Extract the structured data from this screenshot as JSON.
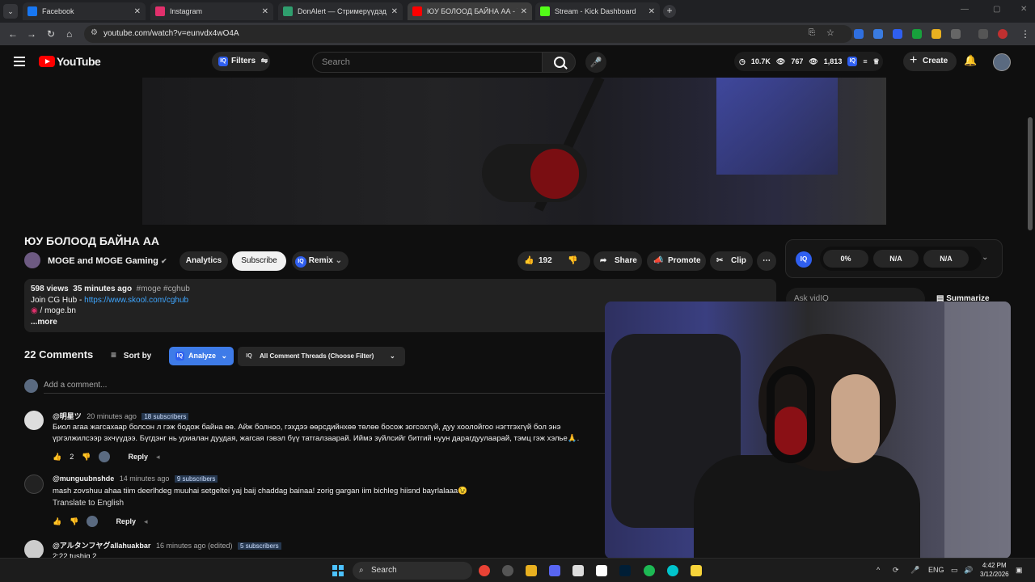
{
  "browser": {
    "tabs": [
      {
        "title": "Facebook",
        "color": "#1877f2"
      },
      {
        "title": "Instagram",
        "color": "#e1306c"
      },
      {
        "title": "DonAlert — Стримерүүдэд зор",
        "color": "#2f9e6e"
      },
      {
        "title": "ЮУ БОЛООД БАЙНА АА - You",
        "color": "#ff0000"
      },
      {
        "title": "Stream - Kick Dashboard",
        "color": "#53fc18"
      }
    ],
    "url": "youtube.com/watch?v=eunvdx4wO4A"
  },
  "header": {
    "logo_text": "YouTube",
    "filters_label": "Filters",
    "search_placeholder": "Search",
    "stats": {
      "views": "10.7K",
      "watching": "767",
      "other": "1,813"
    },
    "create_label": "Create"
  },
  "video": {
    "title": "ЮУ БОЛООД БАЙНА АА",
    "channel": "MOGE and MOGE Gaming",
    "analytics_label": "Analytics",
    "subscribe_label": "Subscribe",
    "remix_label": "Remix",
    "likes": "192",
    "share_label": "Share",
    "promote_label": "Promote",
    "clip_label": "Clip"
  },
  "description": {
    "views": "598 views",
    "time": "35 minutes ago",
    "tags": "#moge #cghub",
    "line1_prefix": "Join CG Hub - ",
    "line1_link": "https://www.skool.com/cghub",
    "line2": "/ moge.bn",
    "more": "...more"
  },
  "comments": {
    "count_label": "22 Comments",
    "sort_label": "Sort by",
    "analyze_label": "Analyze",
    "threads_label": "All Comment Threads (Choose Filter)",
    "add_placeholder": "Add a comment...",
    "reply_label": "Reply",
    "translate_label": "Translate to English",
    "items": [
      {
        "author": "@明星ツ",
        "time": "20 minutes ago",
        "subs": "18 subscribers",
        "text": "Биол агаа жагсахаар болсон л гэж бодож байна өө. Айж болноо, гэхдээ өөрсдийнхөө төлөө босож зогсохгүй, дуу хоолойгоо нэгтгэхгүй бол энэ үргэлжилсээр эхчүүдээ. Бүгдэнг нь уриалан дуудая, жагсая гэвэл бүү татгалзаарай. Иймэ зүйлсийг битгий нуун дарагдуулаарай, тэмц гэж хэлье🙏.",
        "likes": "2"
      },
      {
        "author": "@munguubnshde",
        "time": "14 minutes ago",
        "subs": "9 subscribers",
        "text": "mash zovshuu ahaa tiim deerlhdeg muuhai setgeltei yaj baij chaddag bainaa! zorig gargan iim bichleg hiisnd bayrlalaaa😉",
        "likes": ""
      },
      {
        "author": "@アルタンフヤグallahuakbar",
        "time": "16 minutes ago (edited)",
        "subs": "5 subscribers",
        "text": "2:22 tushig 2",
        "likes": ""
      }
    ]
  },
  "side": {
    "metric1": "0%",
    "metric2": "N/A",
    "metric3": "N/A",
    "ask_placeholder": "Ask vidIQ",
    "summarize_label": "Summarize"
  },
  "taskbar": {
    "search_label": "Search",
    "lang": "ENG",
    "time": "4:42 PM",
    "date": "3/12/2026"
  }
}
